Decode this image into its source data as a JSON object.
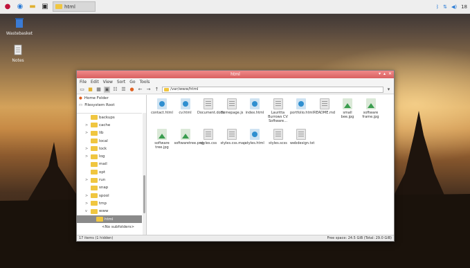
{
  "taskbar": {
    "task_label": "html",
    "clock": "18"
  },
  "desktop": {
    "icons": [
      {
        "label": "Wastebasket"
      },
      {
        "label": "Notes"
      }
    ]
  },
  "window": {
    "title": "html",
    "menu": [
      "File",
      "Edit",
      "View",
      "Sort",
      "Go",
      "Tools"
    ],
    "path": "/var/www/html",
    "places": [
      {
        "label": "Home Folder"
      },
      {
        "label": "Filesystem Root"
      }
    ],
    "tree": [
      {
        "label": "backups",
        "arrow": ""
      },
      {
        "label": "cache",
        "arrow": ">"
      },
      {
        "label": "lib",
        "arrow": ">"
      },
      {
        "label": "local",
        "arrow": ""
      },
      {
        "label": "lock",
        "arrow": ">"
      },
      {
        "label": "log",
        "arrow": ">"
      },
      {
        "label": "mail",
        "arrow": ""
      },
      {
        "label": "opt",
        "arrow": ""
      },
      {
        "label": "run",
        "arrow": ">"
      },
      {
        "label": "snap",
        "arrow": ""
      },
      {
        "label": "spool",
        "arrow": ">"
      },
      {
        "label": "tmp",
        "arrow": ">"
      },
      {
        "label": "www",
        "arrow": "v"
      },
      {
        "label": "html",
        "arrow": "",
        "selected": true
      },
      {
        "label": "<No subfolders>",
        "arrow": ""
      }
    ],
    "files": [
      {
        "name": "contact.html",
        "kind": "html"
      },
      {
        "name": "cv.html",
        "kind": "html"
      },
      {
        "name": "Document.docx",
        "kind": "doc"
      },
      {
        "name": "Homepage.js",
        "kind": "doc"
      },
      {
        "name": "index.html",
        "kind": "html"
      },
      {
        "name": "Lauritta Burrows CV Software...",
        "kind": "doc"
      },
      {
        "name": "portfolio.html",
        "kind": "html"
      },
      {
        "name": "README.md",
        "kind": "doc"
      },
      {
        "name": "small bee.jpg",
        "kind": "img"
      },
      {
        "name": "software frame.jpg",
        "kind": "img"
      },
      {
        "name": "software tree.jpg",
        "kind": "img"
      },
      {
        "name": "softwaretree.png",
        "kind": "img"
      },
      {
        "name": "styles.css",
        "kind": "doc"
      },
      {
        "name": "styles.css.map",
        "kind": "doc"
      },
      {
        "name": "styles.html",
        "kind": "html"
      },
      {
        "name": "styles.scss",
        "kind": "doc"
      },
      {
        "name": "webdesign.txt",
        "kind": "doc"
      }
    ],
    "status_left": "17 items (1 hidden)",
    "status_right": "Free space: 24.5 GiB (Total: 29.0 GiB)"
  },
  "colors": {
    "titlebar": "#d96060",
    "folder": "#f0c640",
    "selection": "#8a8a8a"
  }
}
